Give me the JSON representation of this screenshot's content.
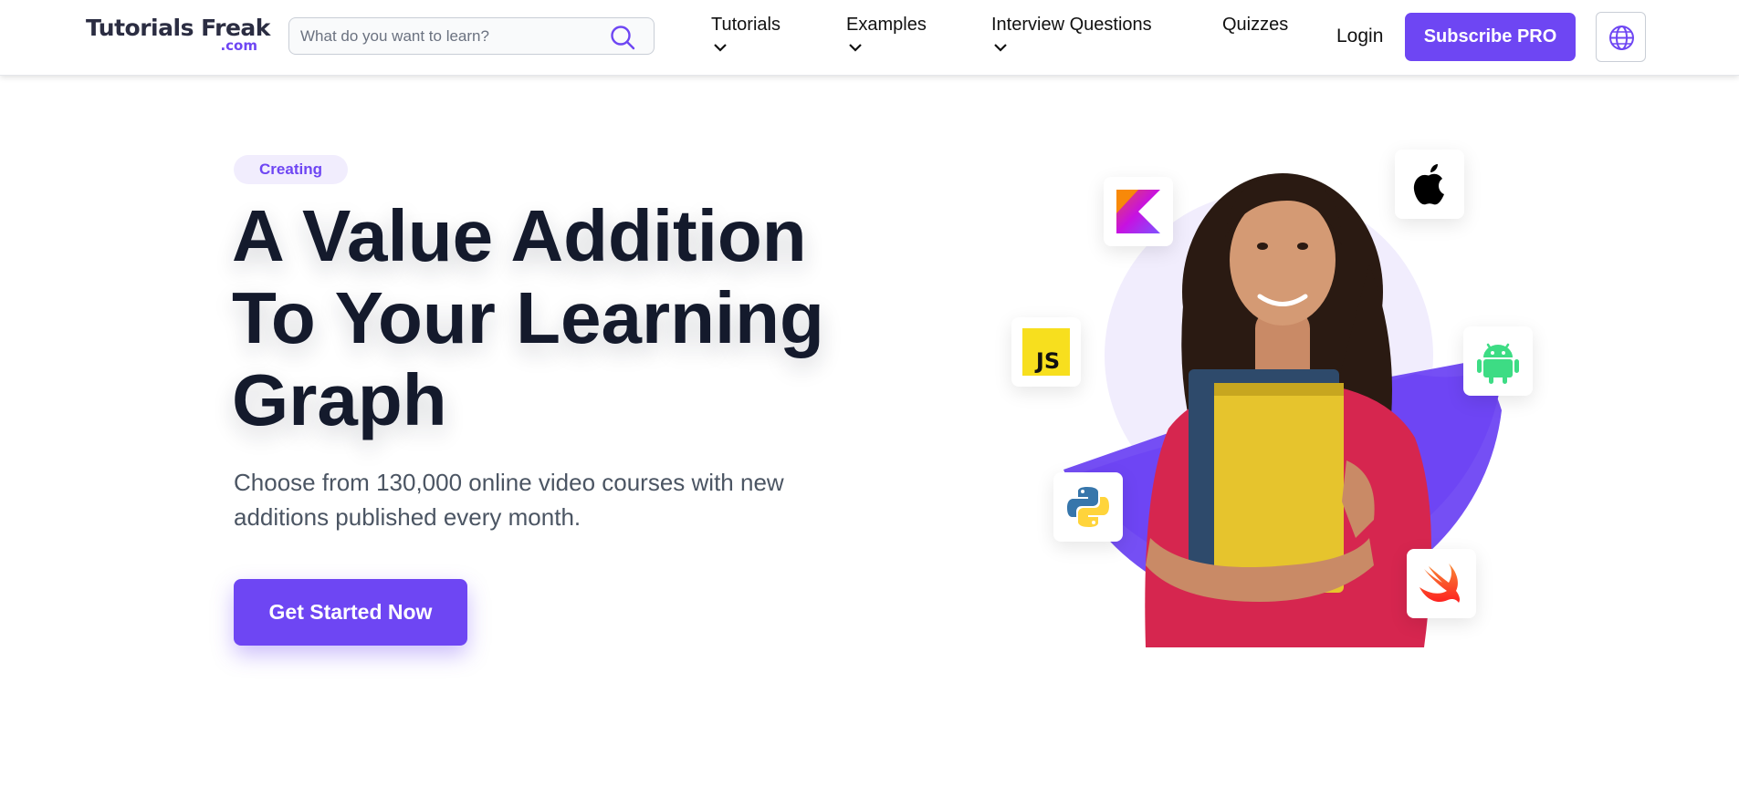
{
  "header": {
    "logo": {
      "main": "Tutorials Freak",
      "sub": ".com"
    },
    "search": {
      "placeholder": "What do you want to learn?"
    },
    "nav": [
      {
        "label": "Tutorials",
        "has_dropdown": true
      },
      {
        "label": "Examples",
        "has_dropdown": true
      },
      {
        "label": "Interview Questions",
        "has_dropdown": true
      },
      {
        "label": "Quizzes",
        "has_dropdown": false
      }
    ],
    "login_label": "Login",
    "subscribe_label": "Subscribe PRO",
    "language_icon": "globe-icon"
  },
  "hero": {
    "badge": "Creating",
    "headline_lines": [
      "A Value Addition",
      "To Your Learning",
      "Graph"
    ],
    "subtext": "Choose from 130,000 online video courses with new additions published every month.",
    "cta_label": "Get Started Now",
    "tech_icons": [
      "kotlin-icon",
      "apple-icon",
      "javascript-icon",
      "android-icon",
      "python-icon",
      "swift-icon"
    ],
    "image": "student-holding-books-photo"
  },
  "colors": {
    "accent": "#6e46f3",
    "accent_light": "#f1edfd",
    "heading": "#141a2c",
    "body_text": "#4b5563"
  }
}
